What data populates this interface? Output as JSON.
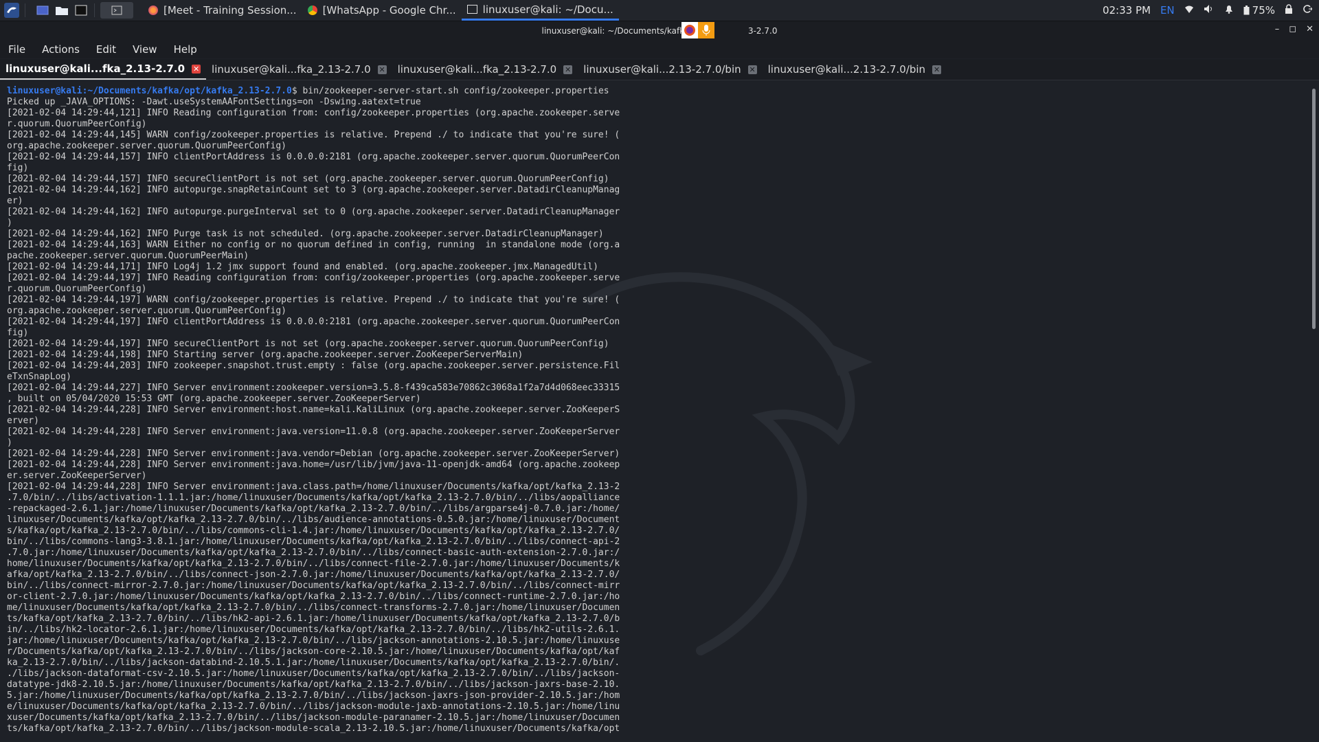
{
  "taskbar": {
    "tasks": [
      {
        "label": "[Meet - Training Session..."
      },
      {
        "label": "[WhatsApp - Google Chr..."
      },
      {
        "label": "linuxuser@kali: ~/Docu..."
      }
    ],
    "clock": "02:33 PM",
    "lang": "EN",
    "battery": "75%"
  },
  "window": {
    "title_left": "linuxuser@kali: ~/Documents/kafka/opt",
    "title_right": "3-2.7.0"
  },
  "menu": [
    "File",
    "Actions",
    "Edit",
    "View",
    "Help"
  ],
  "tabs": [
    {
      "label": "linuxuser@kali...fka_2.13-2.7.0"
    },
    {
      "label": "linuxuser@kali...fka_2.13-2.7.0"
    },
    {
      "label": "linuxuser@kali...fka_2.13-2.7.0"
    },
    {
      "label": "linuxuser@kali...2.13-2.7.0/bin"
    },
    {
      "label": "linuxuser@kali...2.13-2.7.0/bin"
    }
  ],
  "terminal": {
    "prompt_user": "linuxuser@kali",
    "prompt_path": ":~/Documents/kafka/opt/kafka_2.13-2.7.0",
    "command": "$ bin/zookeeper-server-start.sh config/zookeeper.properties",
    "lines": [
      "Picked up _JAVA_OPTIONS: -Dawt.useSystemAAFontSettings=on -Dswing.aatext=true",
      "[2021-02-04 14:29:44,121] INFO Reading configuration from: config/zookeeper.properties (org.apache.zookeeper.serve",
      "r.quorum.QuorumPeerConfig)",
      "[2021-02-04 14:29:44,145] WARN config/zookeeper.properties is relative. Prepend ./ to indicate that you're sure! (",
      "org.apache.zookeeper.server.quorum.QuorumPeerConfig)",
      "[2021-02-04 14:29:44,157] INFO clientPortAddress is 0.0.0.0:2181 (org.apache.zookeeper.server.quorum.QuorumPeerCon",
      "fig)",
      "[2021-02-04 14:29:44,157] INFO secureClientPort is not set (org.apache.zookeeper.server.quorum.QuorumPeerConfig)",
      "[2021-02-04 14:29:44,162] INFO autopurge.snapRetainCount set to 3 (org.apache.zookeeper.server.DatadirCleanupManag",
      "er)",
      "[2021-02-04 14:29:44,162] INFO autopurge.purgeInterval set to 0 (org.apache.zookeeper.server.DatadirCleanupManager",
      ")",
      "[2021-02-04 14:29:44,162] INFO Purge task is not scheduled. (org.apache.zookeeper.server.DatadirCleanupManager)",
      "[2021-02-04 14:29:44,163] WARN Either no config or no quorum defined in config, running  in standalone mode (org.a",
      "pache.zookeeper.server.quorum.QuorumPeerMain)",
      "[2021-02-04 14:29:44,171] INFO Log4j 1.2 jmx support found and enabled. (org.apache.zookeeper.jmx.ManagedUtil)",
      "[2021-02-04 14:29:44,197] INFO Reading configuration from: config/zookeeper.properties (org.apache.zookeeper.serve",
      "r.quorum.QuorumPeerConfig)",
      "[2021-02-04 14:29:44,197] WARN config/zookeeper.properties is relative. Prepend ./ to indicate that you're sure! (",
      "org.apache.zookeeper.server.quorum.QuorumPeerConfig)",
      "[2021-02-04 14:29:44,197] INFO clientPortAddress is 0.0.0.0:2181 (org.apache.zookeeper.server.quorum.QuorumPeerCon",
      "fig)",
      "[2021-02-04 14:29:44,197] INFO secureClientPort is not set (org.apache.zookeeper.server.quorum.QuorumPeerConfig)",
      "[2021-02-04 14:29:44,198] INFO Starting server (org.apache.zookeeper.server.ZooKeeperServerMain)",
      "[2021-02-04 14:29:44,203] INFO zookeeper.snapshot.trust.empty : false (org.apache.zookeeper.server.persistence.Fil",
      "eTxnSnapLog)",
      "[2021-02-04 14:29:44,227] INFO Server environment:zookeeper.version=3.5.8-f439ca583e70862c3068a1f2a7d4d068eec33315",
      ", built on 05/04/2020 15:53 GMT (org.apache.zookeeper.server.ZooKeeperServer)",
      "[2021-02-04 14:29:44,228] INFO Server environment:host.name=kali.KaliLinux (org.apache.zookeeper.server.ZooKeeperS",
      "erver)",
      "[2021-02-04 14:29:44,228] INFO Server environment:java.version=11.0.8 (org.apache.zookeeper.server.ZooKeeperServer",
      ")",
      "[2021-02-04 14:29:44,228] INFO Server environment:java.vendor=Debian (org.apache.zookeeper.server.ZooKeeperServer)",
      "[2021-02-04 14:29:44,228] INFO Server environment:java.home=/usr/lib/jvm/java-11-openjdk-amd64 (org.apache.zookeep",
      "er.server.ZooKeeperServer)",
      "[2021-02-04 14:29:44,228] INFO Server environment:java.class.path=/home/linuxuser/Documents/kafka/opt/kafka_2.13-2",
      ".7.0/bin/../libs/activation-1.1.1.jar:/home/linuxuser/Documents/kafka/opt/kafka_2.13-2.7.0/bin/../libs/aopalliance",
      "-repackaged-2.6.1.jar:/home/linuxuser/Documents/kafka/opt/kafka_2.13-2.7.0/bin/../libs/argparse4j-0.7.0.jar:/home/",
      "linuxuser/Documents/kafka/opt/kafka_2.13-2.7.0/bin/../libs/audience-annotations-0.5.0.jar:/home/linuxuser/Document",
      "s/kafka/opt/kafka_2.13-2.7.0/bin/../libs/commons-cli-1.4.jar:/home/linuxuser/Documents/kafka/opt/kafka_2.13-2.7.0/",
      "bin/../libs/commons-lang3-3.8.1.jar:/home/linuxuser/Documents/kafka/opt/kafka_2.13-2.7.0/bin/../libs/connect-api-2",
      ".7.0.jar:/home/linuxuser/Documents/kafka/opt/kafka_2.13-2.7.0/bin/../libs/connect-basic-auth-extension-2.7.0.jar:/",
      "home/linuxuser/Documents/kafka/opt/kafka_2.13-2.7.0/bin/../libs/connect-file-2.7.0.jar:/home/linuxuser/Documents/k",
      "afka/opt/kafka_2.13-2.7.0/bin/../libs/connect-json-2.7.0.jar:/home/linuxuser/Documents/kafka/opt/kafka_2.13-2.7.0/",
      "bin/../libs/connect-mirror-2.7.0.jar:/home/linuxuser/Documents/kafka/opt/kafka_2.13-2.7.0/bin/../libs/connect-mirr",
      "or-client-2.7.0.jar:/home/linuxuser/Documents/kafka/opt/kafka_2.13-2.7.0/bin/../libs/connect-runtime-2.7.0.jar:/ho",
      "me/linuxuser/Documents/kafka/opt/kafka_2.13-2.7.0/bin/../libs/connect-transforms-2.7.0.jar:/home/linuxuser/Documen",
      "ts/kafka/opt/kafka_2.13-2.7.0/bin/../libs/hk2-api-2.6.1.jar:/home/linuxuser/Documents/kafka/opt/kafka_2.13-2.7.0/b",
      "in/../libs/hk2-locator-2.6.1.jar:/home/linuxuser/Documents/kafka/opt/kafka_2.13-2.7.0/bin/../libs/hk2-utils-2.6.1.",
      "jar:/home/linuxuser/Documents/kafka/opt/kafka_2.13-2.7.0/bin/../libs/jackson-annotations-2.10.5.jar:/home/linuxuse",
      "r/Documents/kafka/opt/kafka_2.13-2.7.0/bin/../libs/jackson-core-2.10.5.jar:/home/linuxuser/Documents/kafka/opt/kaf",
      "ka_2.13-2.7.0/bin/../libs/jackson-databind-2.10.5.1.jar:/home/linuxuser/Documents/kafka/opt/kafka_2.13-2.7.0/bin/.",
      "./libs/jackson-dataformat-csv-2.10.5.jar:/home/linuxuser/Documents/kafka/opt/kafka_2.13-2.7.0/bin/../libs/jackson-",
      "datatype-jdk8-2.10.5.jar:/home/linuxuser/Documents/kafka/opt/kafka_2.13-2.7.0/bin/../libs/jackson-jaxrs-base-2.10.",
      "5.jar:/home/linuxuser/Documents/kafka/opt/kafka_2.13-2.7.0/bin/../libs/jackson-jaxrs-json-provider-2.10.5.jar:/hom",
      "e/linuxuser/Documents/kafka/opt/kafka_2.13-2.7.0/bin/../libs/jackson-module-jaxb-annotations-2.10.5.jar:/home/linu",
      "xuser/Documents/kafka/opt/kafka_2.13-2.7.0/bin/../libs/jackson-module-paranamer-2.10.5.jar:/home/linuxuser/Documen",
      "ts/kafka/opt/kafka_2.13-2.7.0/bin/../libs/jackson-module-scala_2.13-2.10.5.jar:/home/linuxuser/Documents/kafka/opt"
    ]
  },
  "colors": {
    "accent": "#367bf0",
    "terminal_bg": "#1e2127",
    "close_active": "#e0443e"
  }
}
